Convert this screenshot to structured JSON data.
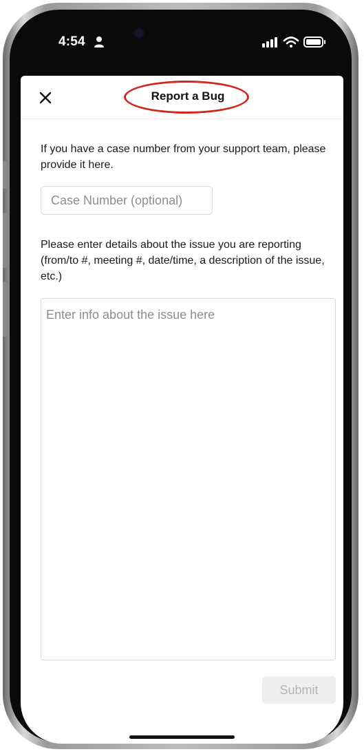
{
  "status_bar": {
    "time": "4:54",
    "person_icon": "person-icon",
    "signal_icon": "cellular-signal-icon",
    "wifi_icon": "wifi-icon",
    "battery_icon": "battery-icon"
  },
  "header": {
    "title": "Report a Bug",
    "close_icon": "close-icon",
    "highlight_color": "#d0281e"
  },
  "form": {
    "case_prompt": "If you have a case number from your support team, please provide it here.",
    "case_input": {
      "value": "",
      "placeholder": "Case Number (optional)"
    },
    "details_prompt": "Please enter details about the issue you are reporting (from/to #, meeting #, date/time, a description of the issue, etc.)",
    "details_input": {
      "value": "",
      "placeholder": "Enter info about the issue here"
    },
    "submit_label": "Submit"
  }
}
